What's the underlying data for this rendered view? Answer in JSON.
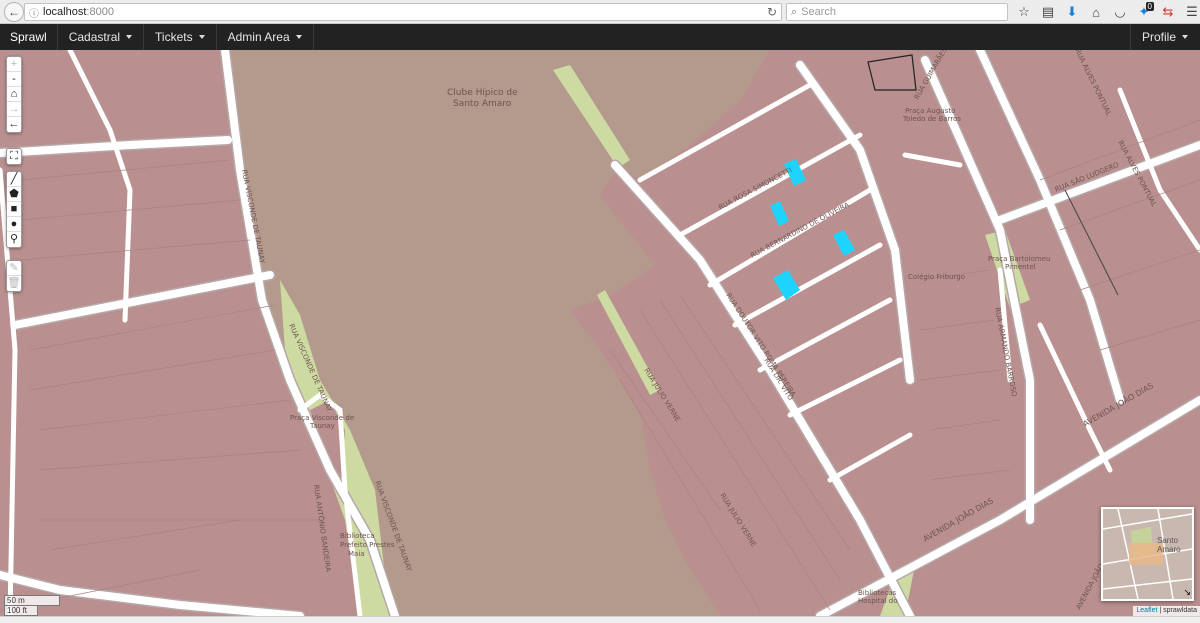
{
  "browser": {
    "url_host": "localhost",
    "url_port": ":8000",
    "search_placeholder": "Search",
    "badge_count": "0"
  },
  "navbar": {
    "brand": "Sprawl",
    "menus": [
      {
        "label": "Cadastral"
      },
      {
        "label": "Tickets"
      },
      {
        "label": "Admin Area"
      }
    ],
    "profile_label": "Profile"
  },
  "map": {
    "streets": {
      "r1": "RUA VISCONDE DE TAUNAY",
      "r2": "RUA VISCONDE DE TAUNAY",
      "r3": "RUA VISCONDE DE TAUNAY",
      "r4": "RUA ANTÔNIO BANDEIRA",
      "r5": "RUA DOUTOR VITO ROMA PEREIRA",
      "r6": "RUA JÚLIO VERNE",
      "r7": "RUA JÚLIO VERNE",
      "r8": "AVENIDA JOÃO DIAS",
      "r9": "AVENIDA JOÃO DIAS",
      "r10": "RUA SÃO LUDGERO",
      "r11": "RUA ALVES PONTUAL",
      "r12": "RUA ARMANDO BARROSO",
      "r13": "RUA GUIMARÃES",
      "r14": "RUA ROSA SIMONCETTI",
      "r15": "RUA BERNARDINO DE OLIVEIRA",
      "r16": "RUA DR. VITO",
      "r17": "AVENIDA JOÃO DIAS",
      "r18": "RUA ALVES PONTUAL"
    },
    "places": {
      "club_line1": "Clube Hípico de",
      "club_line2": "Santo Amaro",
      "praca1_line1": "Praça Visconde de",
      "praca1_line2": "Taunay",
      "biblio_line1": "Biblioteca",
      "biblio_line2": "Prefeito Prestes",
      "biblio_line3": "Maia",
      "colegio": "Colégio Friburgo",
      "praca2_line1": "Praça Augusto",
      "praca2_line2": "Toledo de Barros",
      "praca3_line1": "Praça Bartolomeu",
      "praca3_line2": "Pimentel",
      "hospital_line1": "Bibliotecas",
      "hospital_line2": "Hospital do"
    },
    "colors": {
      "base": "#b9908f",
      "block": "#bb9495",
      "club": "#b49a8c",
      "park": "#cddba2",
      "road": "#ffffff",
      "road_edge": "#b7a7a7",
      "highlight": "#1ed4ff"
    }
  },
  "controls": {
    "zoom_in": "+",
    "zoom_out": "-",
    "home_icon": "⌂",
    "forward_icon": "→",
    "back_icon": "←",
    "fullscreen_icon": "⛶",
    "draw_line_icon": "╱",
    "draw_polygon_icon": "⬟",
    "draw_rectangle_icon": "■",
    "draw_circle_icon": "●",
    "draw_marker_icon": "⚲",
    "edit_icon": "✎",
    "delete_icon": "🗑"
  },
  "scale": {
    "metric": "50 m",
    "imperial": "100 ft"
  },
  "minimap": {
    "label_line1": "Santo",
    "label_line2": "Amaro",
    "toggle_icon": "↘"
  },
  "attribution": {
    "leaflet": "Leaflet",
    "separator": " | ",
    "source": "sprawldata"
  }
}
